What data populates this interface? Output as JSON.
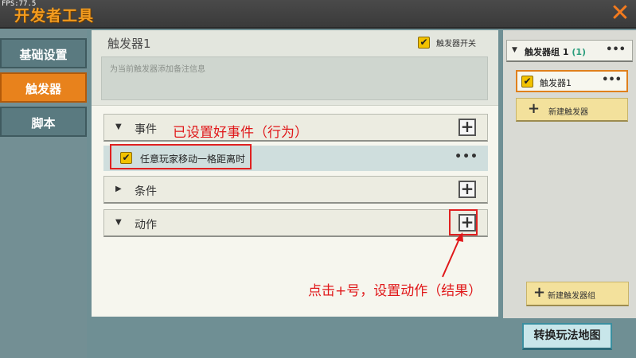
{
  "fps": "FPS:77.5",
  "window": {
    "title": "开发者工具",
    "close_icon": "close-icon"
  },
  "sidebar": {
    "items": [
      {
        "label": "基础设置"
      },
      {
        "label": "触发器"
      },
      {
        "label": "脚本"
      }
    ]
  },
  "trigger": {
    "title": "触发器1",
    "switch_label": "触发器开关",
    "switch_checked": true,
    "note_placeholder": "为当前触发器添加备注信息"
  },
  "sections": {
    "event": {
      "label": "事件",
      "expanded": true
    },
    "condition": {
      "label": "条件",
      "expanded": false
    },
    "action": {
      "label": "动作",
      "expanded": true
    }
  },
  "event_item": {
    "label": "任意玩家移动一格距离时",
    "more": "•••",
    "checked": true
  },
  "annotations": {
    "event_note": "已设置好事件（行为）",
    "action_note": "点击+号，设置动作（结果）"
  },
  "right_panel": {
    "group_label": "触发器组 1",
    "group_count": "(1)",
    "more": "•••",
    "trigger_item": "触发器1",
    "new_trigger": "新建触发器",
    "new_group": "新建触发器组"
  },
  "bottom": {
    "switch_map": "转换玩法地图"
  },
  "colors": {
    "accent": "#e8821c",
    "annotation": "#e0181a",
    "checkbox": "#f2c200"
  }
}
